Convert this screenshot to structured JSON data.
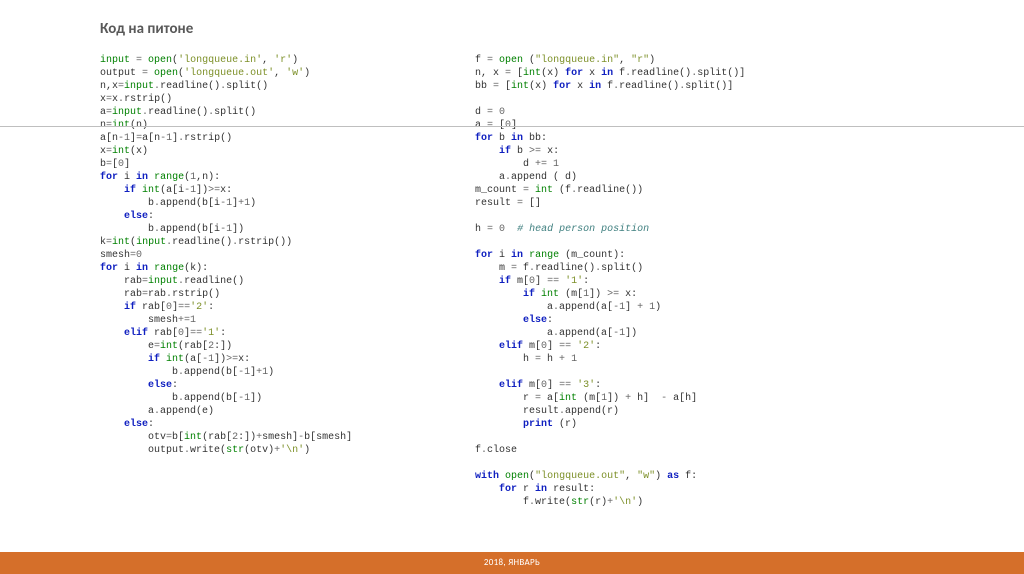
{
  "title": "Код на питоне",
  "footer": "2018, ЯНВАРЬ",
  "left": {
    "l1a": "input",
    "l1b": " = ",
    "l1c": "open",
    "l1d": "(",
    "l1e": "'longqueue.in'",
    "l1f": ", ",
    "l1g": "'r'",
    "l1h": ")",
    "l2a": "output ",
    "l2b": "= ",
    "l2c": "open",
    "l2d": "(",
    "l2e": "'longqueue.out'",
    "l2f": ", ",
    "l2g": "'w'",
    "l2h": ")",
    "l3a": "n,x",
    "l3b": "=",
    "l3c": "input",
    "l3d": ".",
    "l3e": "readline",
    "l3f": "()",
    "l3g": ".",
    "l3h": "split",
    "l3i": "()",
    "l4a": "x",
    "l4b": "=",
    "l4c": "x",
    "l4d": ".",
    "l4e": "rstrip",
    "l4f": "()",
    "l5a": "a",
    "l5b": "=",
    "l5c": "input",
    "l5d": ".",
    "l5e": "readline",
    "l5f": "()",
    "l5g": ".",
    "l5h": "split",
    "l5i": "()",
    "l6a": "n",
    "l6b": "=",
    "l6c": "int",
    "l6d": "(n)",
    "l7a": "a[n",
    "l7b": "-",
    "l7c": "1",
    "l7d": "]",
    "l7e": "=",
    "l7f": "a[n",
    "l7g": "-",
    "l7h": "1",
    "l7i": "]",
    "l7j": ".",
    "l7k": "rstrip",
    "l7l": "()",
    "l8a": "x",
    "l8b": "=",
    "l8c": "int",
    "l8d": "(x)",
    "l9a": "b",
    "l9b": "=",
    "l9c": "[",
    "l9d": "0",
    "l9e": "]",
    "l10a": "for",
    "l10b": " i ",
    "l10c": "in",
    "l10d": " ",
    "l10e": "range",
    "l10f": "(",
    "l10g": "1",
    "l10h": ",n):",
    "l11a": "    ",
    "l11b": "if",
    "l11c": " ",
    "l11d": "int",
    "l11e": "(a[i",
    "l11f": "-",
    "l11g": "1",
    "l11h": "])",
    "l11i": ">=",
    "l11j": "x:",
    "l12a": "        b",
    "l12b": ".",
    "l12c": "append",
    "l12d": "(b[i",
    "l12e": "-",
    "l12f": "1",
    "l12g": "]",
    "l12h": "+",
    "l12i": "1",
    "l12j": ")",
    "l13a": "    ",
    "l13b": "else",
    "l13c": ":",
    "l14a": "        b",
    "l14b": ".",
    "l14c": "append",
    "l14d": "(b[i",
    "l14e": "-",
    "l14f": "1",
    "l14g": "])",
    "l15a": "k",
    "l15b": "=",
    "l15c": "int",
    "l15d": "(",
    "l15e": "input",
    "l15f": ".",
    "l15g": "readline",
    "l15h": "()",
    "l15i": ".",
    "l15j": "rstrip",
    "l15k": "())",
    "l16a": "smesh",
    "l16b": "=",
    "l16c": "0",
    "l17a": "for",
    "l17b": " i ",
    "l17c": "in",
    "l17d": " ",
    "l17e": "range",
    "l17f": "(k):",
    "l18a": "    rab",
    "l18b": "=",
    "l18c": "input",
    "l18d": ".",
    "l18e": "readline",
    "l18f": "()",
    "l19a": "    rab",
    "l19b": "=",
    "l19c": "rab",
    "l19d": ".",
    "l19e": "rstrip",
    "l19f": "()",
    "l20a": "    ",
    "l20b": "if",
    "l20c": " rab[",
    "l20d": "0",
    "l20e": "]",
    "l20f": "==",
    "l20g": "'2'",
    "l20h": ":",
    "l21a": "        smesh",
    "l21b": "+=",
    "l21c": "1",
    "l22a": "    ",
    "l22b": "elif",
    "l22c": " rab[",
    "l22d": "0",
    "l22e": "]",
    "l22f": "==",
    "l22g": "'1'",
    "l22h": ":",
    "l23a": "        e",
    "l23b": "=",
    "l23c": "int",
    "l23d": "(rab[",
    "l23e": "2",
    "l23f": ":])",
    "l24a": "        ",
    "l24b": "if",
    "l24c": " ",
    "l24d": "int",
    "l24e": "(a[",
    "l24f": "-",
    "l24g": "1",
    "l24h": "])",
    "l24i": ">=",
    "l24j": "x:",
    "l25a": "            b",
    "l25b": ".",
    "l25c": "append",
    "l25d": "(b[",
    "l25e": "-",
    "l25f": "1",
    "l25g": "]",
    "l25h": "+",
    "l25i": "1",
    "l25j": ")",
    "l26a": "        ",
    "l26b": "else",
    "l26c": ":",
    "l27a": "            b",
    "l27b": ".",
    "l27c": "append",
    "l27d": "(b[",
    "l27e": "-",
    "l27f": "1",
    "l27g": "])",
    "l28a": "        a",
    "l28b": ".",
    "l28c": "append",
    "l28d": "(e)",
    "l29a": "    ",
    "l29b": "else",
    "l29c": ":",
    "l30a": "        otv",
    "l30b": "=",
    "l30c": "b[",
    "l30d": "int",
    "l30e": "(rab[",
    "l30f": "2",
    "l30g": ":])",
    "l30h": "+",
    "l30i": "smesh]",
    "l30j": "-",
    "l30k": "b[smesh]",
    "l31a": "        output",
    "l31b": ".",
    "l31c": "write",
    "l31d": "(",
    "l31e": "str",
    "l31f": "(otv)",
    "l31g": "+",
    "l31h": "'\\n'",
    "l31i": ")"
  },
  "right": {
    "r1a": "f ",
    "r1b": "= ",
    "r1c": "open",
    "r1d": " (",
    "r1e": "\"longqueue.in\"",
    "r1f": ", ",
    "r1g": "\"r\"",
    "r1h": ")",
    "r2a": "n, x ",
    "r2b": "= ",
    "r2c": "[",
    "r2d": "int",
    "r2e": "(x) ",
    "r2f": "for",
    "r2g": " x ",
    "r2h": "in",
    "r2i": " f",
    "r2j": ".",
    "r2k": "readline",
    "r2l": "()",
    "r2m": ".",
    "r2n": "split",
    "r2o": "()]",
    "r3a": "bb ",
    "r3b": "= ",
    "r3c": "[",
    "r3d": "int",
    "r3e": "(x) ",
    "r3f": "for",
    "r3g": " x ",
    "r3h": "in",
    "r3i": " f",
    "r3j": ".",
    "r3k": "readline",
    "r3l": "()",
    "r3m": ".",
    "r3n": "split",
    "r3o": "()]",
    "r5a": "d ",
    "r5b": "= ",
    "r5c": "0",
    "r6a": "a ",
    "r6b": "= ",
    "r6c": "[",
    "r6d": "0",
    "r6e": "]",
    "r7a": "for",
    "r7b": " b ",
    "r7c": "in",
    "r7d": " bb:",
    "r8a": "    ",
    "r8b": "if",
    "r8c": " b ",
    "r8d": ">= ",
    "r8e": "x:",
    "r9a": "        d ",
    "r9b": "+= ",
    "r9c": "1",
    "r10a": "    a",
    "r10b": ".",
    "r10c": "append",
    "r10d": " ( d)",
    "r11a": "m_count ",
    "r11b": "= ",
    "r11c": "int",
    "r11d": " (f",
    "r11e": ".",
    "r11f": "readline",
    "r11g": "())",
    "r12a": "result ",
    "r12b": "= ",
    "r12c": "[]",
    "r14a": "h ",
    "r14b": "= ",
    "r14c": "0",
    "r14d": "  ",
    "r14e": "# head person position",
    "r16a": "for",
    "r16b": " i ",
    "r16c": "in",
    "r16d": " ",
    "r16e": "range",
    "r16f": " (m_count):",
    "r17a": "    m ",
    "r17b": "= ",
    "r17c": "f",
    "r17d": ".",
    "r17e": "readline",
    "r17f": "()",
    "r17g": ".",
    "r17h": "split",
    "r17i": "()",
    "r18a": "    ",
    "r18b": "if",
    "r18c": " m[",
    "r18d": "0",
    "r18e": "] ",
    "r18f": "== ",
    "r18g": "'1'",
    "r18h": ":",
    "r19a": "        ",
    "r19b": "if",
    "r19c": " ",
    "r19d": "int",
    "r19e": " (m[",
    "r19f": "1",
    "r19g": "]) ",
    "r19h": ">= ",
    "r19i": "x:",
    "r20a": "            a",
    "r20b": ".",
    "r20c": "append",
    "r20d": "(a[",
    "r20e": "-",
    "r20f": "1",
    "r20g": "] ",
    "r20h": "+ ",
    "r20i": "1",
    "r20j": ")",
    "r21a": "        ",
    "r21b": "else",
    "r21c": ":",
    "r22a": "            a",
    "r22b": ".",
    "r22c": "append",
    "r22d": "(a[",
    "r22e": "-",
    "r22f": "1",
    "r22g": "])",
    "r23a": "    ",
    "r23b": "elif",
    "r23c": " m[",
    "r23d": "0",
    "r23e": "] ",
    "r23f": "== ",
    "r23g": "'2'",
    "r23h": ":",
    "r24a": "        h ",
    "r24b": "= ",
    "r24c": "h ",
    "r24d": "+ ",
    "r24e": "1",
    "r26a": "    ",
    "r26b": "elif",
    "r26c": " m[",
    "r26d": "0",
    "r26e": "] ",
    "r26f": "== ",
    "r26g": "'3'",
    "r26h": ":",
    "r27a": "        r ",
    "r27b": "= ",
    "r27c": "a[",
    "r27d": "int",
    "r27e": " (m[",
    "r27f": "1",
    "r27g": "]) ",
    "r27h": "+ ",
    "r27i": "h]  ",
    "r27j": "- ",
    "r27k": "a[h]",
    "r28a": "        result",
    "r28b": ".",
    "r28c": "append",
    "r28d": "(r)",
    "r29a": "        ",
    "r29b": "print",
    "r29c": " (r)",
    "r31a": "f",
    "r31b": ".",
    "r31c": "close",
    "r33a": "with",
    "r33b": " ",
    "r33c": "open",
    "r33d": "(",
    "r33e": "\"longqueue.out\"",
    "r33f": ", ",
    "r33g": "\"w\"",
    "r33h": ") ",
    "r33i": "as",
    "r33j": " f:",
    "r34a": "    ",
    "r34b": "for",
    "r34c": " r ",
    "r34d": "in",
    "r34e": " result:",
    "r35a": "        f",
    "r35b": ".",
    "r35c": "write",
    "r35d": "(",
    "r35e": "str",
    "r35f": "(r)",
    "r35g": "+",
    "r35h": "'\\n'",
    "r35i": ")"
  }
}
